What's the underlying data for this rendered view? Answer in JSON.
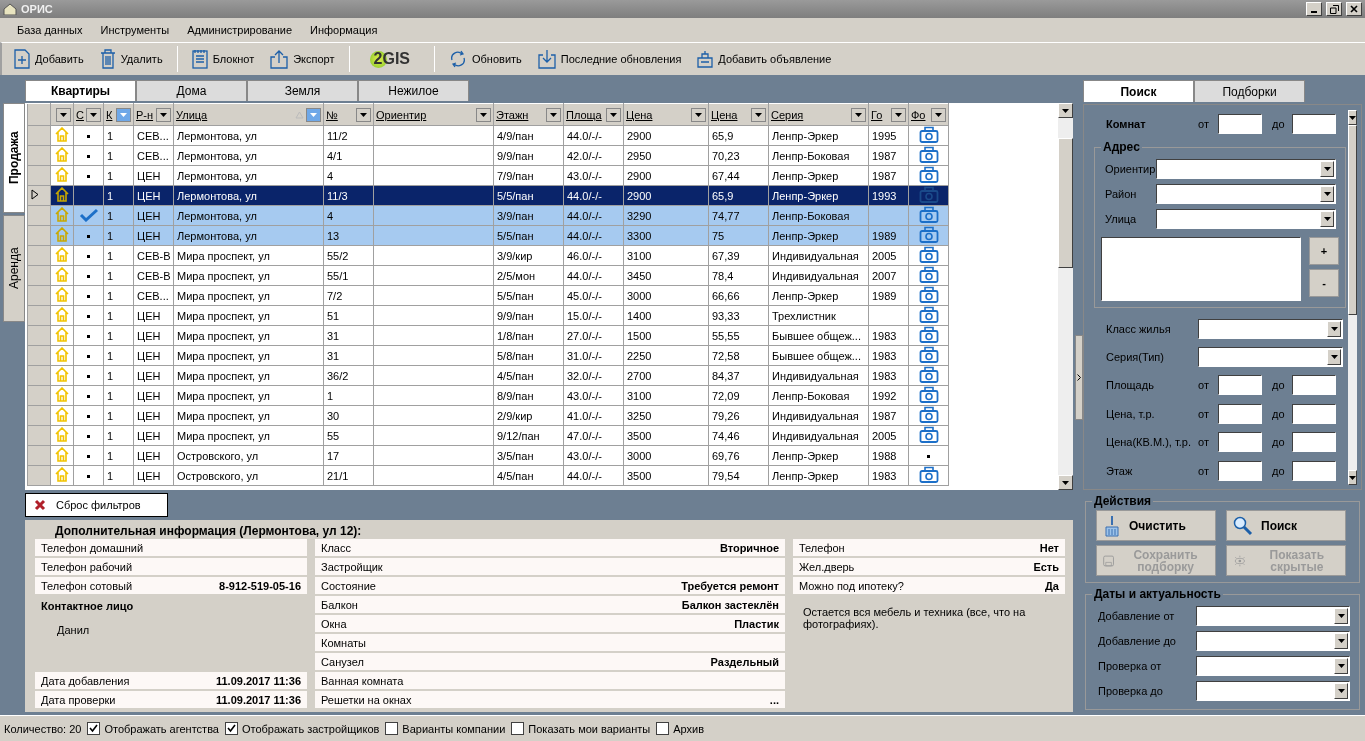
{
  "window": {
    "title": "ОРИС"
  },
  "menu": [
    "База данных",
    "Инструменты",
    "Администрирование",
    "Информация"
  ],
  "toolbar": [
    {
      "kind": "button",
      "label": "Добавить"
    },
    {
      "kind": "button",
      "label": "Удалить"
    },
    {
      "kind": "separator"
    },
    {
      "kind": "button",
      "label": "Блокнот"
    },
    {
      "kind": "button",
      "label": "Экспорт"
    },
    {
      "kind": "separator"
    },
    {
      "kind": "logo",
      "label": "2GIS"
    },
    {
      "kind": "separator"
    },
    {
      "kind": "button",
      "label": "Обновить"
    },
    {
      "kind": "button",
      "label": "Последние обновления"
    },
    {
      "kind": "button",
      "label": "Добавить объявление"
    }
  ],
  "tabs": [
    {
      "label": "Квартиры",
      "selected": true
    },
    {
      "label": "Дома",
      "selected": false
    },
    {
      "label": "Земля",
      "selected": false
    },
    {
      "label": "Нежилое",
      "selected": false
    }
  ],
  "side_tabs": [
    {
      "label": "Продажа",
      "selected": true
    },
    {
      "label": "Аренда",
      "selected": false
    }
  ],
  "grid": {
    "columns": [
      {
        "filtered": false
      },
      {
        "label": "С",
        "filtered": false
      },
      {
        "label": "К",
        "filtered": true
      },
      {
        "label": "Р-н",
        "filtered": false
      },
      {
        "label": "Улица",
        "filtered": true,
        "sorted": true
      },
      {
        "label": "№",
        "filtered": false
      },
      {
        "label": "Ориентир",
        "filtered": false
      },
      {
        "label": "Этажн",
        "filtered": false
      },
      {
        "label": "Площа",
        "filtered": false
      },
      {
        "label": "Цена",
        "filtered": false
      },
      {
        "label": "Цена",
        "filtered": false
      },
      {
        "label": "Серия",
        "filtered": false
      },
      {
        "label": "Го",
        "filtered": false
      },
      {
        "label": "Фо",
        "filtered": false
      }
    ],
    "rows": [
      {
        "checked": false,
        "k": "1",
        "district": "СЕВ...",
        "street": "Лермонтова, ул",
        "num": "11/2",
        "floors": "4/9/пан",
        "area": "44.0/-/-",
        "price": "2900",
        "price_m2": "65,9",
        "series": "Ленпр-Эркер",
        "year": "1995",
        "photo": true,
        "current": false,
        "selected": false
      },
      {
        "checked": false,
        "k": "1",
        "district": "СЕВ...",
        "street": "Лермонтова, ул",
        "num": "4/1",
        "floors": "9/9/пан",
        "area": "42.0/-/-",
        "price": "2950",
        "price_m2": "70,23",
        "series": "Ленпр-Боковая",
        "year": "1987",
        "photo": true,
        "current": false,
        "selected": false
      },
      {
        "checked": false,
        "k": "1",
        "district": "ЦЕН",
        "street": "Лермонтова, ул",
        "num": "4",
        "floors": "7/9/пан",
        "area": "43.0/-/-",
        "price": "2900",
        "price_m2": "67,44",
        "series": "Ленпр-Эркер",
        "year": "1987",
        "photo": true,
        "current": false,
        "selected": false
      },
      {
        "checked": false,
        "k": "1",
        "district": "ЦЕН",
        "street": "Лермонтова, ул",
        "num": "11/3",
        "floors": "5/5/пан",
        "area": "44.0/-/-",
        "price": "2900",
        "price_m2": "65,9",
        "series": "Ленпр-Эркер",
        "year": "1993",
        "photo": true,
        "current": true,
        "selected": false
      },
      {
        "checked": true,
        "k": "1",
        "district": "ЦЕН",
        "street": "Лермонтова, ул",
        "num": "4",
        "floors": "3/9/пан",
        "area": "44.0/-/-",
        "price": "3290",
        "price_m2": "74,77",
        "series": "Ленпр-Боковая",
        "photo": true,
        "current": false,
        "selected": true
      },
      {
        "checked": false,
        "k": "1",
        "district": "ЦЕН",
        "street": "Лермонтова, ул",
        "num": "13",
        "floors": "5/5/пан",
        "area": "44.0/-/-",
        "price": "3300",
        "price_m2": "75",
        "series": "Ленпр-Эркер",
        "year": "1989",
        "photo": true,
        "current": false,
        "selected": true
      },
      {
        "checked": false,
        "k": "1",
        "district": "СЕВ-В",
        "street": "Мира проспект, ул",
        "num": "55/2",
        "floors": "3/9/кир",
        "area": "46.0/-/-",
        "price": "3100",
        "price_m2": "67,39",
        "series": "Индивидуальная",
        "year": "2005",
        "photo": true,
        "current": false,
        "selected": false
      },
      {
        "checked": false,
        "k": "1",
        "district": "СЕВ-В",
        "street": "Мира проспект, ул",
        "num": "55/1",
        "floors": "2/5/мон",
        "area": "44.0/-/-",
        "price": "3450",
        "price_m2": "78,4",
        "series": "Индивидуальная",
        "year": "2007",
        "photo": true,
        "current": false,
        "selected": false
      },
      {
        "checked": false,
        "k": "1",
        "district": "СЕВ...",
        "street": "Мира проспект, ул",
        "num": "7/2",
        "floors": "5/5/пан",
        "area": "45.0/-/-",
        "price": "3000",
        "price_m2": "66,66",
        "series": "Ленпр-Эркер",
        "year": "1989",
        "photo": true,
        "current": false,
        "selected": false
      },
      {
        "checked": false,
        "k": "1",
        "district": "ЦЕН",
        "street": "Мира проспект, ул",
        "num": "51",
        "floors": "9/9/пан",
        "area": "15.0/-/-",
        "price": "1400",
        "price_m2": "93,33",
        "series": "Трехлистник",
        "photo": true,
        "current": false,
        "selected": false
      },
      {
        "checked": false,
        "k": "1",
        "district": "ЦЕН",
        "street": "Мира проспект, ул",
        "num": "31",
        "floors": "1/8/пан",
        "area": "27.0/-/-",
        "price": "1500",
        "price_m2": "55,55",
        "series": "Бывшее общеж...",
        "year": "1983",
        "photo": true,
        "current": false,
        "selected": false
      },
      {
        "checked": false,
        "k": "1",
        "district": "ЦЕН",
        "street": "Мира проспект, ул",
        "num": "31",
        "floors": "5/8/пан",
        "area": "31.0/-/-",
        "price": "2250",
        "price_m2": "72,58",
        "series": "Бывшее общеж...",
        "year": "1983",
        "photo": true,
        "current": false,
        "selected": false
      },
      {
        "checked": false,
        "k": "1",
        "district": "ЦЕН",
        "street": "Мира проспект, ул",
        "num": "36/2",
        "floors": "4/5/пан",
        "area": "32.0/-/-",
        "price": "2700",
        "price_m2": "84,37",
        "series": "Индивидуальная",
        "year": "1983",
        "photo": true,
        "current": false,
        "selected": false
      },
      {
        "checked": false,
        "k": "1",
        "district": "ЦЕН",
        "street": "Мира проспект, ул",
        "num": "1",
        "floors": "8/9/пан",
        "area": "43.0/-/-",
        "price": "3100",
        "price_m2": "72,09",
        "series": "Ленпр-Боковая",
        "year": "1992",
        "photo": true,
        "current": false,
        "selected": false
      },
      {
        "checked": false,
        "k": "1",
        "district": "ЦЕН",
        "street": "Мира проспект, ул",
        "num": "30",
        "floors": "2/9/кир",
        "area": "41.0/-/-",
        "price": "3250",
        "price_m2": "79,26",
        "series": "Индивидуальная",
        "year": "1987",
        "photo": true,
        "current": false,
        "selected": false
      },
      {
        "checked": false,
        "k": "1",
        "district": "ЦЕН",
        "street": "Мира проспект, ул",
        "num": "55",
        "floors": "9/12/пан",
        "area": "47.0/-/-",
        "price": "3500",
        "price_m2": "74,46",
        "series": "Индивидуальная",
        "year": "2005",
        "photo": true,
        "current": false,
        "selected": false
      },
      {
        "checked": false,
        "k": "1",
        "district": "ЦЕН",
        "street": "Островского, ул",
        "num": "17",
        "floors": "3/5/пан",
        "area": "43.0/-/-",
        "price": "3000",
        "price_m2": "69,76",
        "series": "Ленпр-Эркер",
        "year": "1988",
        "photo": false,
        "current": false,
        "selected": false
      },
      {
        "checked": false,
        "k": "1",
        "district": "ЦЕН",
        "street": "Островского, ул",
        "num": "21/1",
        "floors": "4/5/пан",
        "area": "44.0/-/-",
        "price": "3500",
        "price_m2": "79,54",
        "series": "Ленпр-Эркер",
        "year": "1983",
        "photo": true,
        "current": false,
        "selected": false
      }
    ]
  },
  "reset_button": "Сброс фильтров",
  "info": {
    "title": "Дополнительная информация (Лермонтова, ул 12):",
    "left": [
      {
        "label": "Телефон домашний"
      },
      {
        "label": "Телефон рабочий"
      },
      {
        "label": "Телефон сотовый",
        "value": "8-912-519-05-16"
      }
    ],
    "contact": {
      "title": "Контактное лицо",
      "name": "Данил"
    },
    "dates": [
      {
        "label": "Дата добавления",
        "value": "11.09.2017 11:36"
      },
      {
        "label": "Дата проверки",
        "value": "11.09.2017 11:36"
      }
    ],
    "middle": [
      {
        "label": "Класс",
        "value": "Вторичное"
      },
      {
        "label": "Застройщик"
      },
      {
        "label": "Состояние",
        "value": "Требуется ремонт"
      },
      {
        "label": "Балкон",
        "value": "Балкон застеклён"
      },
      {
        "label": "Окна",
        "value": "Пластик"
      },
      {
        "label": "Комнаты"
      },
      {
        "label": "Санузел",
        "value": "Раздельный"
      },
      {
        "label": "Ванная комната"
      },
      {
        "label": "Решетки на окнах",
        "value": "..."
      }
    ],
    "right": [
      {
        "label": "Телефон",
        "value": "Нет"
      },
      {
        "label": "Жел.дверь",
        "value": "Есть"
      },
      {
        "label": "Можно под ипотеку?",
        "value": "Да"
      }
    ],
    "note": "Остается вся мебель и техника (все, что на фотографиях)."
  },
  "search_panel": {
    "tabs": [
      {
        "label": "Поиск",
        "selected": true
      },
      {
        "label": "Подборки",
        "selected": false
      }
    ],
    "rooms": {
      "label": "Комнат",
      "from": "от",
      "to": "до"
    },
    "address": {
      "title": "Адрес",
      "combos": [
        "Ориентир",
        "Район",
        "Улица"
      ],
      "add_button": "+",
      "remove_button": "-"
    },
    "fields": [
      {
        "kind": "combo",
        "label": "Класс жилья"
      },
      {
        "kind": "combo",
        "label": "Серия(Тип)"
      },
      {
        "kind": "range",
        "label": "Площадь",
        "from": "от",
        "to": "до"
      },
      {
        "kind": "range",
        "label": "Цена, т.р.",
        "from": "от",
        "to": "до"
      },
      {
        "kind": "range",
        "label": "Цена(КВ.М.), т.р.",
        "from": "от",
        "to": "до"
      },
      {
        "kind": "range",
        "label": "Этаж",
        "from": "от",
        "to": "до"
      }
    ]
  },
  "actions": {
    "title": "Действия",
    "buttons": [
      {
        "label": "Очистить",
        "disabled": false
      },
      {
        "label": "Поиск",
        "disabled": false
      },
      {
        "label": "Сохранить подборку",
        "disabled": true
      },
      {
        "label": "Показать скрытые",
        "disabled": true
      }
    ]
  },
  "dates_panel": {
    "title": "Даты и актуальность",
    "combos": [
      "Добавление от",
      "Добавление до",
      "Проверка от",
      "Проверка до"
    ]
  },
  "status_bar": {
    "count": "Количество: 20",
    "options": [
      {
        "label": "Отображать агентства",
        "checked": true
      },
      {
        "label": "Отображать застройщиков",
        "checked": true
      },
      {
        "label": "Варианты компании",
        "checked": false
      },
      {
        "label": "Показать мои варианты",
        "checked": false
      },
      {
        "label": "Архив",
        "checked": false
      }
    ]
  }
}
